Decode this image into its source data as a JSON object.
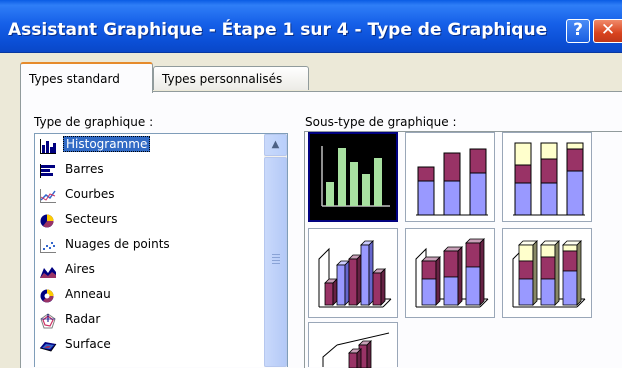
{
  "window": {
    "title": "Assistant Graphique - Étape 1 sur 4 - Type de Graphique",
    "help_label": "?",
    "close_label": "✕"
  },
  "tabs": [
    {
      "label": "Types standard",
      "active": true
    },
    {
      "label": "Types personnalisés",
      "active": false
    }
  ],
  "chart_type": {
    "label": "Type de graphique :",
    "items": [
      {
        "label": "Histogramme",
        "icon": "column-chart-icon",
        "selected": true
      },
      {
        "label": "Barres",
        "icon": "bar-chart-icon"
      },
      {
        "label": "Courbes",
        "icon": "line-chart-icon"
      },
      {
        "label": "Secteurs",
        "icon": "pie-chart-icon"
      },
      {
        "label": "Nuages de points",
        "icon": "scatter-chart-icon"
      },
      {
        "label": "Aires",
        "icon": "area-chart-icon"
      },
      {
        "label": "Anneau",
        "icon": "doughnut-chart-icon"
      },
      {
        "label": "Radar",
        "icon": "radar-chart-icon"
      },
      {
        "label": "Surface",
        "icon": "surface-chart-icon"
      }
    ]
  },
  "subtype": {
    "label": "Sous-type de graphique :",
    "items": [
      {
        "name": "clustered-column",
        "selected": true
      },
      {
        "name": "stacked-column"
      },
      {
        "name": "stacked-column-100"
      },
      {
        "name": "clustered-column-3d-effect"
      },
      {
        "name": "stacked-column-3d-effect"
      },
      {
        "name": "stacked-column-100-3d-effect"
      },
      {
        "name": "column-3d"
      }
    ]
  },
  "colors": {
    "titlebar": "#0b52d9",
    "selection": "#316ac5",
    "series_purple": "#993366",
    "series_blue": "#9999ff",
    "series_cream": "#ffffcc",
    "series_green": "#a8e0a0"
  }
}
